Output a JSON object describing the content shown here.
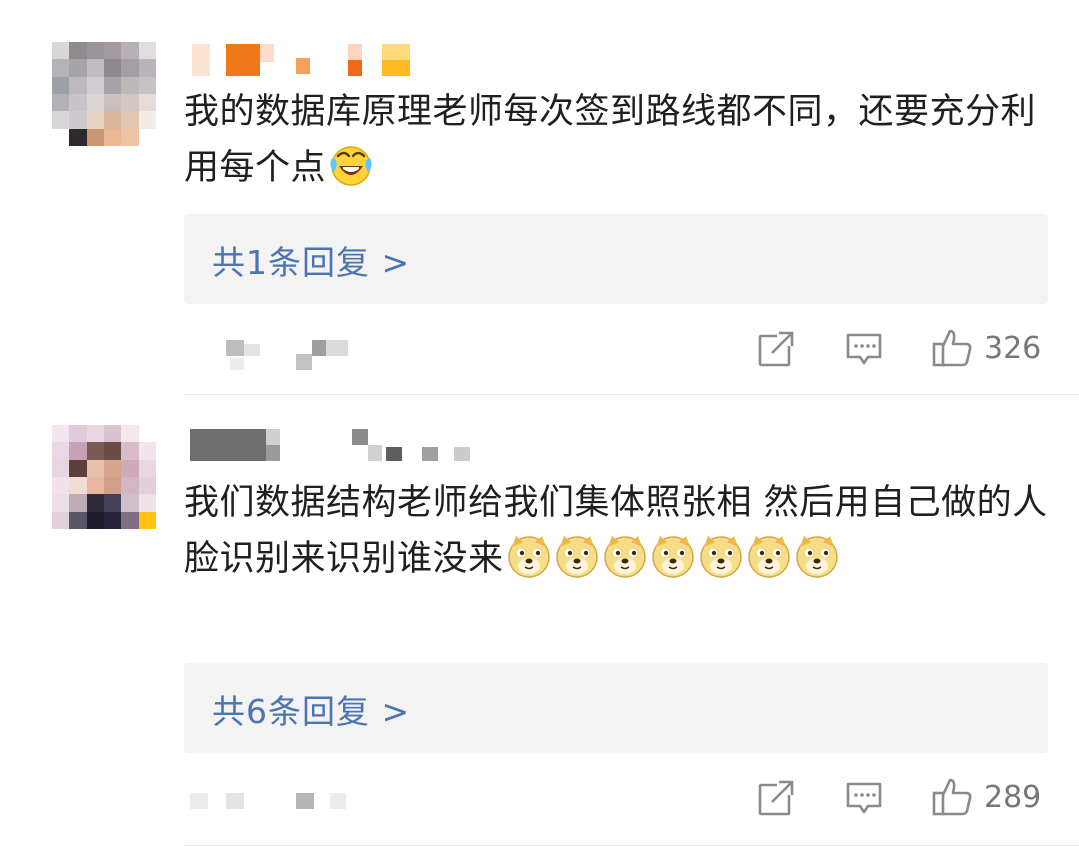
{
  "comments": [
    {
      "text": "我的数据库原理老师每次签到路线都不同，还要充分利用每个点",
      "emojis": [
        "laughing-tears-emoji"
      ],
      "reply_label": "共1条回复 >",
      "like_count": "326"
    },
    {
      "text": "我们数据结构老师给我们集体照张相 然后用自己做的人脸识别来识别谁没来",
      "emojis": [
        "doge-emoji",
        "doge-emoji",
        "doge-emoji",
        "doge-emoji",
        "doge-emoji",
        "doge-emoji",
        "doge-emoji"
      ],
      "reply_label": "共6条回复 >",
      "like_count": "289"
    }
  ],
  "icons": {
    "share": "share-icon",
    "comment": "comment-icon",
    "like": "thumbs-up-icon"
  },
  "colors": {
    "reply_link": "#4a75b0",
    "reply_bg": "#f3f3f4",
    "icon_gray": "#8a8a8a"
  }
}
